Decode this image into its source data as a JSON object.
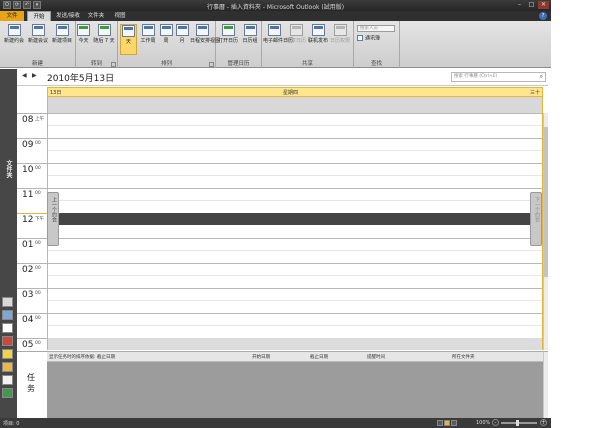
{
  "window": {
    "title": "行事曆 - 插入資料夾 - Microsoft Outlook (試用版)",
    "controls": [
      "–",
      "□",
      "✕"
    ]
  },
  "ribbon_tabs": [
    "文件",
    "开始",
    "发送/接收",
    "文件夹",
    "视图"
  ],
  "ribbon": {
    "groups": {
      "new": {
        "label": "新建",
        "buttons": [
          "新建约会",
          "新建会议",
          "新建项目"
        ]
      },
      "goto": {
        "label": "转到",
        "buttons": [
          "今天",
          "随后 7 天"
        ]
      },
      "arrange": {
        "label": "排列",
        "buttons": [
          "天",
          "工作周",
          "周",
          "月",
          "日程安排视图"
        ]
      },
      "manage": {
        "label": "管理日历",
        "buttons": [
          "打开日历",
          "日历组"
        ]
      },
      "share": {
        "label": "共享",
        "buttons": [
          "电子邮件日历",
          "共享日历",
          "联机发布",
          "日历权限"
        ]
      },
      "find": {
        "label": "查找",
        "search_placeholder": "搜索人员",
        "addressbook": "通讯簿"
      }
    }
  },
  "navigation": {
    "folder_pane_label": "文件夹"
  },
  "calendar": {
    "date_title": "2010年5月13日",
    "search_placeholder": "搜索 行事曆 (Ctrl+E)",
    "day_number": "13日",
    "weekday": "星期四",
    "corner_label": "三十",
    "hours": [
      {
        "hour": "08",
        "suffix": "上午"
      },
      {
        "hour": "09",
        "suffix": "00"
      },
      {
        "hour": "10",
        "suffix": "00"
      },
      {
        "hour": "11",
        "suffix": "00"
      },
      {
        "hour": "12",
        "suffix": "下午"
      },
      {
        "hour": "01",
        "suffix": "00"
      },
      {
        "hour": "02",
        "suffix": "00"
      },
      {
        "hour": "03",
        "suffix": "00"
      },
      {
        "hour": "04",
        "suffix": "00"
      },
      {
        "hour": "05",
        "suffix": "00"
      }
    ],
    "previous_appointment": "上一个约会",
    "next_appointment": "下一个约会"
  },
  "tasks": {
    "label": "任务",
    "columns": [
      "显示任务时的排序依据: 截止日期",
      "开始日期",
      "截止日期",
      "提醒时间",
      "所在文件夹"
    ]
  },
  "statusbar": {
    "items_text": "项目: 0",
    "zoom": "100%"
  }
}
